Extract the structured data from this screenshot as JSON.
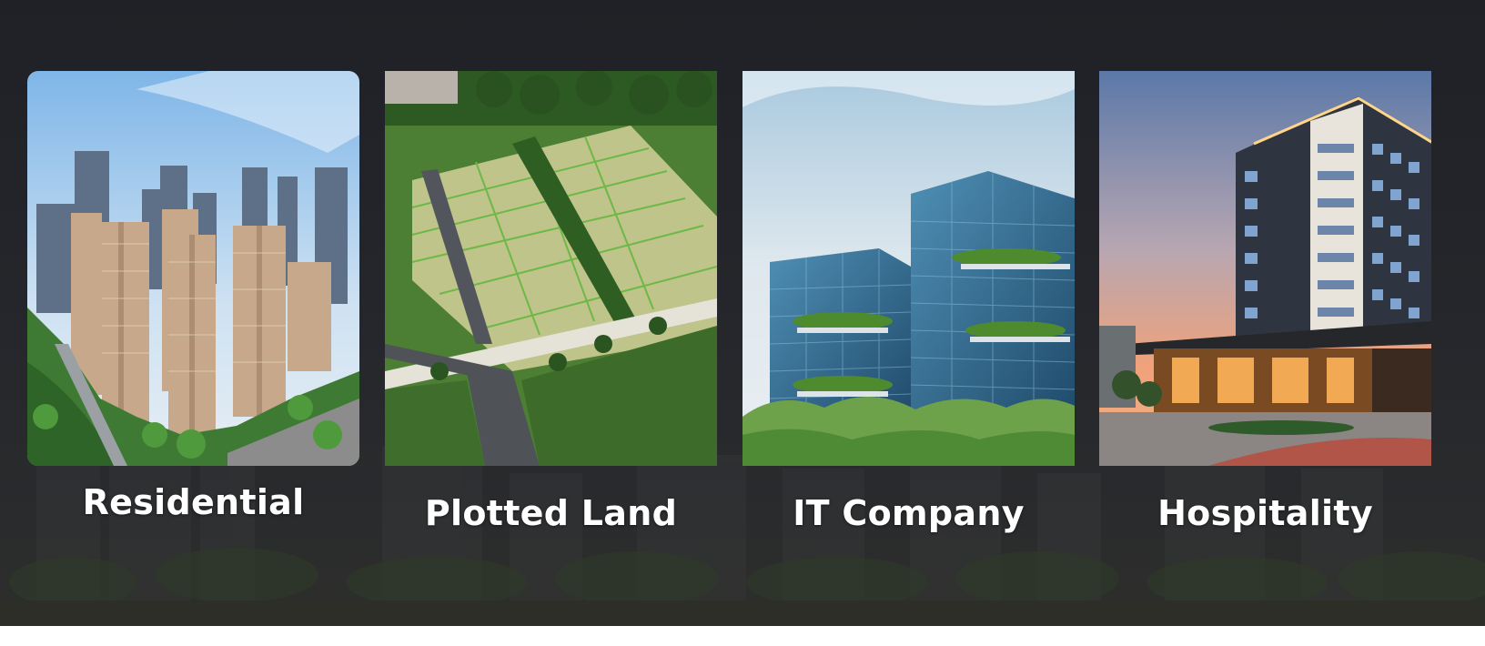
{
  "categories": [
    {
      "label": "Residential",
      "image": "residential-towers-photo"
    },
    {
      "label": "Plotted Land",
      "image": "plotted-land-aerial-photo"
    },
    {
      "label": "IT Company",
      "image": "glass-office-building-photo"
    },
    {
      "label": "Hospitality",
      "image": "hotel-building-dusk-photo"
    }
  ],
  "colors": {
    "background": "#23252a",
    "label_text": "#ffffff"
  }
}
